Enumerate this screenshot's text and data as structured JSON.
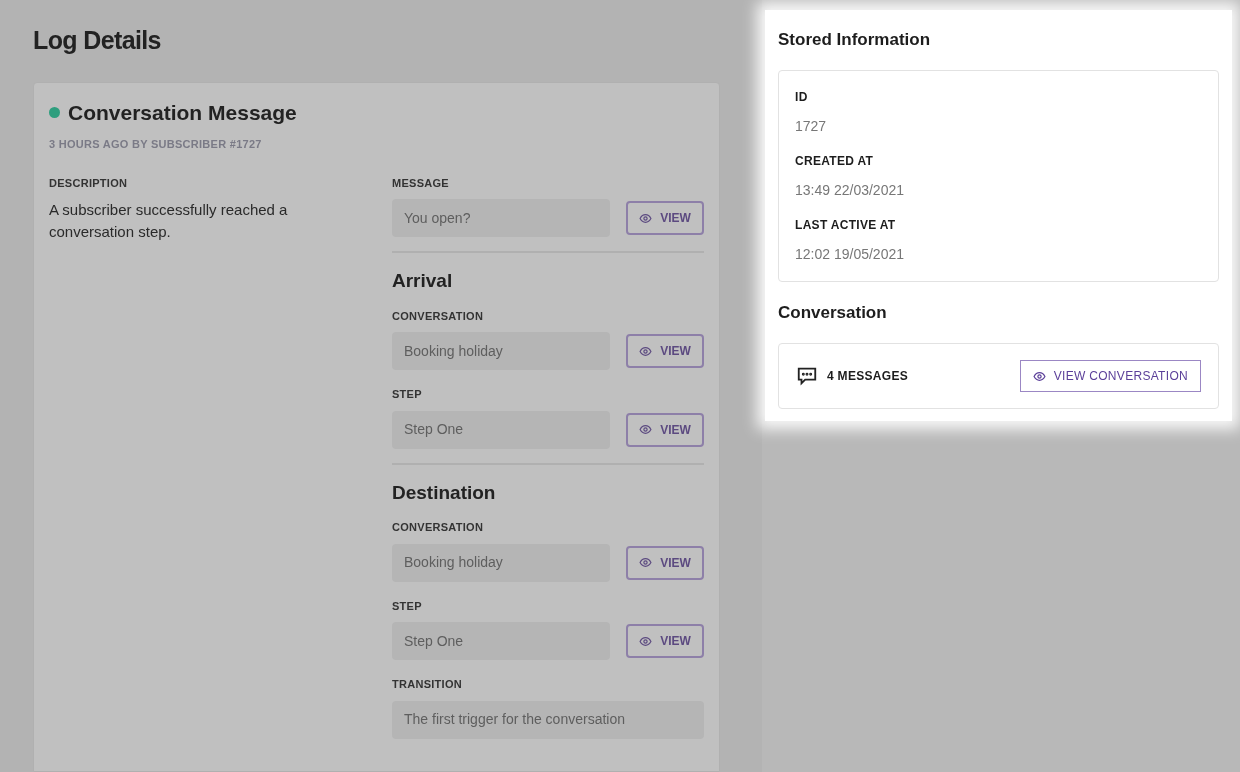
{
  "page_title": "Log Details",
  "log": {
    "title": "Conversation Message",
    "color": "#2e9e7e",
    "meta": "3 HOURS AGO BY SUBSCRIBER #1727",
    "description_label": "DESCRIPTION",
    "description": "A subscriber successfully reached a conversation step.",
    "groups": [
      {
        "fields": [
          {
            "kind": "viewable",
            "label": "MESSAGE",
            "value": "You open?",
            "button": "VIEW"
          }
        ]
      },
      {
        "heading": "Arrival",
        "fields": [
          {
            "kind": "viewable",
            "label": "CONVERSATION",
            "value": "Booking holiday",
            "button": "VIEW"
          },
          {
            "kind": "viewable",
            "label": "STEP",
            "value": "Step One",
            "button": "VIEW"
          }
        ]
      },
      {
        "heading": "Destination",
        "fields": [
          {
            "kind": "viewable",
            "label": "CONVERSATION",
            "value": "Booking holiday",
            "button": "VIEW"
          },
          {
            "kind": "viewable",
            "label": "STEP",
            "value": "Step One",
            "button": "VIEW"
          },
          {
            "kind": "plain",
            "label": "TRANSITION",
            "value": "The first trigger for the conversation"
          }
        ]
      }
    ]
  },
  "stored": {
    "title": "Stored Information",
    "items": [
      {
        "label": "ID",
        "value": "1727"
      },
      {
        "label": "CREATED AT",
        "value": "13:49 22/03/2021"
      },
      {
        "label": "LAST ACTIVE AT",
        "value": "12:02 19/05/2021"
      }
    ]
  },
  "conversation": {
    "title": "Conversation",
    "count": "4 MESSAGES",
    "button": "VIEW CONVERSATION"
  }
}
